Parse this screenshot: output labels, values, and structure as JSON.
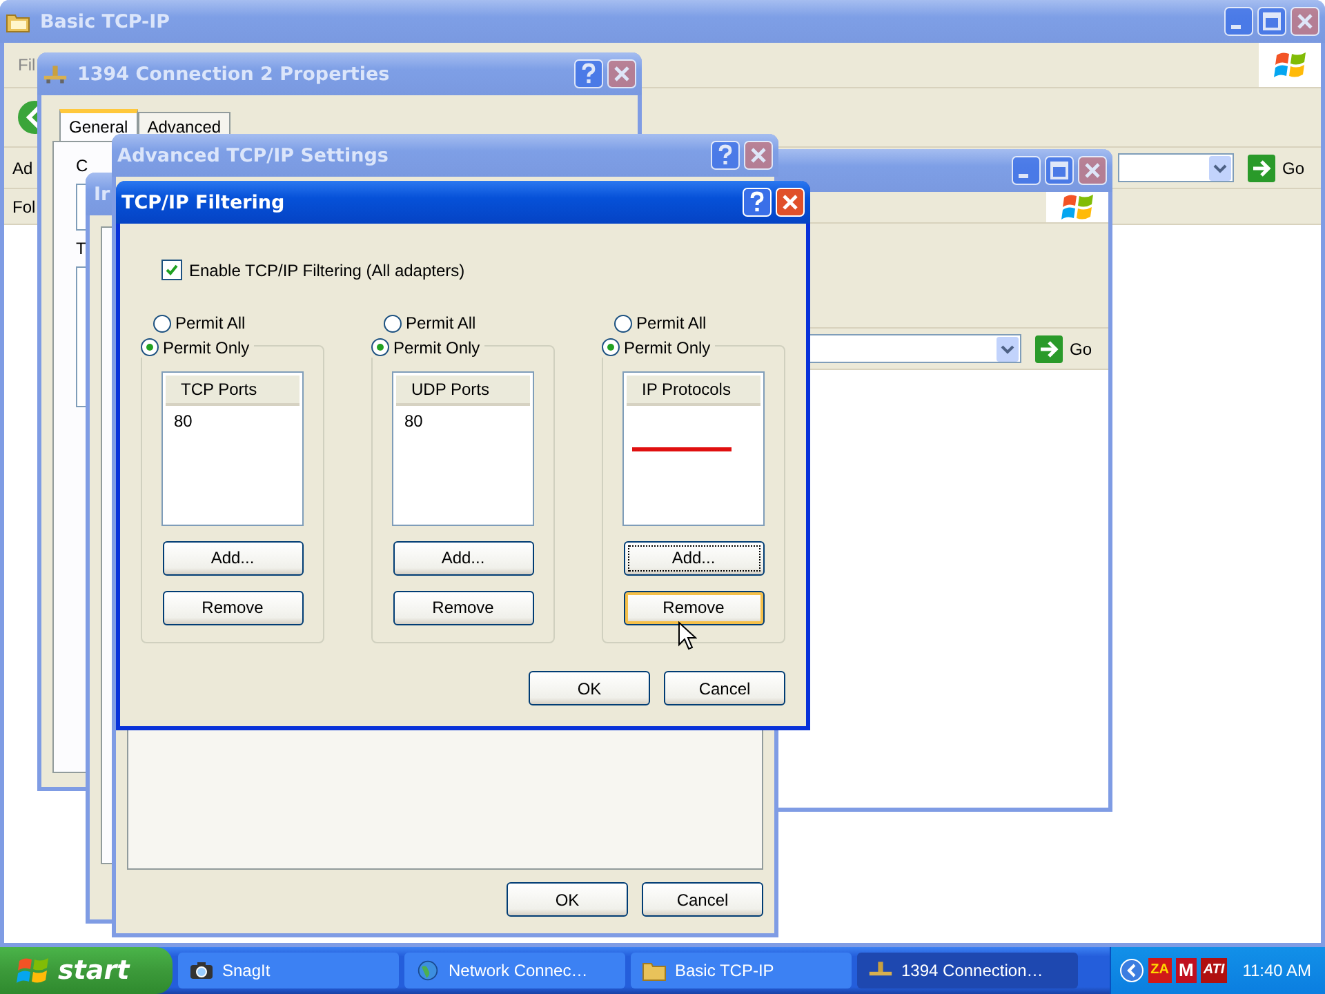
{
  "basic_window": {
    "title": "Basic TCP-IP",
    "active": false,
    "menu_text": "Fil",
    "address_label": "Ad",
    "go_label": "Go",
    "folders_label": "Fol"
  },
  "properties_window": {
    "title": "1394 Connection 2 Properties",
    "active": false,
    "tabs": [
      {
        "label": "General",
        "selected": true
      },
      {
        "label": "Advanced",
        "selected": false
      }
    ],
    "labels": [
      "C",
      "T"
    ]
  },
  "explorer_window": {
    "active": false,
    "go_label": "Go"
  },
  "ip_window": {
    "title": "Ir",
    "active": false
  },
  "advanced_window": {
    "title": "Advanced TCP/IP Settings",
    "active": false,
    "buttons": [
      "OK",
      "Cancel"
    ]
  },
  "filtering_dialog": {
    "title": "TCP/IP Filtering",
    "active": true,
    "enable": {
      "label": "Enable TCP/IP Filtering (All adapters)",
      "checked": true
    },
    "groups": [
      {
        "options": [
          {
            "label": "Permit All",
            "selected": false
          },
          {
            "label": "Permit Only",
            "selected": true
          }
        ],
        "list_header": "TCP Ports",
        "items": [
          "80"
        ],
        "buttons": [
          {
            "label": "Add...",
            "focused": false,
            "hovered": false
          },
          {
            "label": "Remove",
            "focused": false,
            "hovered": false
          }
        ]
      },
      {
        "options": [
          {
            "label": "Permit All",
            "selected": false
          },
          {
            "label": "Permit Only",
            "selected": true
          }
        ],
        "list_header": "UDP Ports",
        "items": [
          "80"
        ],
        "buttons": [
          {
            "label": "Add...",
            "focused": false,
            "hovered": false
          },
          {
            "label": "Remove",
            "focused": false,
            "hovered": false
          }
        ]
      },
      {
        "options": [
          {
            "label": "Permit All",
            "selected": false
          },
          {
            "label": "Permit Only",
            "selected": true
          }
        ],
        "list_header": "IP Protocols",
        "buttons": [
          {
            "label": "Add...",
            "focused": true,
            "hovered": false
          },
          {
            "label": "Remove",
            "focused": false,
            "hovered": true
          }
        ]
      }
    ],
    "buttons": [
      "OK",
      "Cancel"
    ]
  },
  "taskbar": {
    "start_label": "start",
    "items": [
      {
        "kind": "camera",
        "label": "SnagIt",
        "selected": false
      },
      {
        "kind": "network",
        "label": "Network Connec…",
        "selected": false
      },
      {
        "kind": "folder",
        "label": "Basic TCP-IP",
        "selected": false
      },
      {
        "kind": "connection",
        "label": "1394 Connection…",
        "selected": true
      }
    ],
    "tray_icons": [
      "ZA",
      "M",
      "ATI"
    ],
    "clock": "11:40 AM"
  }
}
